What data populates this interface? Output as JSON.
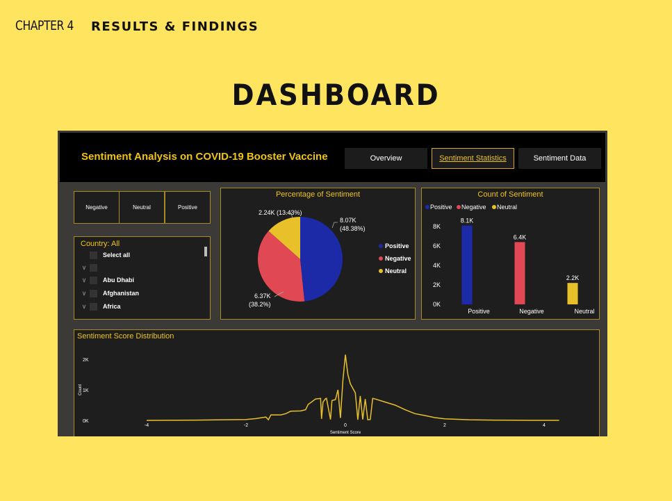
{
  "slide": {
    "chapter": "CHAPTER 4",
    "section": "RESULTS & FINDINGS",
    "title": "DASHBOARD"
  },
  "dashboard": {
    "title": "Sentiment Analysis on COVID-19 Booster Vaccine",
    "tabs": [
      {
        "label": "Overview",
        "active": false
      },
      {
        "label": "Sentiment Statistics",
        "active": true
      },
      {
        "label": "Sentiment Data",
        "active": false
      }
    ],
    "filter_buttons": [
      "Negative",
      "Neutral",
      "Positive"
    ],
    "slicer": {
      "title": "Country: All",
      "items": [
        "Select all",
        "",
        "Abu Dhabi",
        "Afghanistan",
        "Africa"
      ]
    },
    "pie": {
      "title": "Percentage of Sentiment",
      "legend": [
        "Positive",
        "Negative",
        "Neutral"
      ],
      "labels": {
        "positive": [
          "8.07K",
          "(48.38%)"
        ],
        "negative": [
          "6.37K",
          "(38.2%)"
        ],
        "neutral": [
          "2.24K (13.43%)"
        ]
      }
    },
    "count": {
      "title": "Count of Sentiment",
      "legend": [
        "Positive",
        "Negative",
        "Neutral"
      ]
    },
    "distribution": {
      "title": "Sentiment Score Distribution"
    }
  },
  "colors": {
    "positive": "#1c2aa8",
    "negative": "#e04853",
    "neutral": "#e8c12a",
    "accent": "#f0c419"
  },
  "chart_data": [
    {
      "type": "pie",
      "title": "Percentage of Sentiment",
      "categories": [
        "Positive",
        "Negative",
        "Neutral"
      ],
      "values": [
        8070,
        6370,
        2240
      ],
      "percentages": [
        48.38,
        38.2,
        13.43
      ],
      "data_labels": [
        "8.07K (48.38%)",
        "6.37K (38.2%)",
        "2.24K (13.43%)"
      ],
      "legend": "right"
    },
    {
      "type": "bar",
      "title": "Count of Sentiment",
      "categories": [
        "Positive",
        "Negative",
        "Neutral"
      ],
      "values": [
        8100,
        6400,
        2200
      ],
      "data_labels": [
        "8.1K",
        "6.4K",
        "2.2K"
      ],
      "yticks": [
        "0K",
        "2K",
        "4K",
        "6K",
        "8K"
      ],
      "ylim": [
        0,
        8000
      ],
      "legend": "top-left"
    },
    {
      "type": "line",
      "title": "Sentiment Score Distribution",
      "xlabel": "Sentiment Score",
      "ylabel": "Count",
      "xticks": [
        "-4",
        "-2",
        "0",
        "2",
        "4"
      ],
      "yticks": [
        "0K",
        "1K",
        "2K"
      ],
      "xlim": [
        -4.5,
        4.5
      ],
      "ylim": [
        0,
        2300
      ],
      "x": [
        -4.0,
        -3.5,
        -3.0,
        -2.5,
        -2.0,
        -1.8,
        -1.6,
        -1.55,
        -1.5,
        -1.3,
        -1.2,
        -1.1,
        -0.9,
        -0.8,
        -0.75,
        -0.6,
        -0.5,
        -0.48,
        -0.45,
        -0.4,
        -0.38,
        -0.3,
        -0.27,
        -0.2,
        -0.15,
        -0.1,
        -0.05,
        0.0,
        0.05,
        0.1,
        0.2,
        0.25,
        0.3,
        0.35,
        0.4,
        0.45,
        0.5,
        0.55,
        0.6,
        0.8,
        1.0,
        1.2,
        1.4,
        1.6,
        1.8,
        2.0,
        2.5,
        3.0,
        3.5,
        4.0,
        4.3
      ],
      "y": [
        0,
        5,
        10,
        20,
        30,
        60,
        110,
        20,
        180,
        180,
        220,
        300,
        310,
        350,
        520,
        700,
        720,
        50,
        600,
        710,
        720,
        30,
        650,
        680,
        1000,
        80,
        1300,
        2150,
        1500,
        1200,
        900,
        20,
        800,
        30,
        700,
        20,
        30,
        720,
        700,
        600,
        500,
        350,
        220,
        160,
        90,
        50,
        20,
        10,
        5,
        3,
        2
      ]
    }
  ]
}
